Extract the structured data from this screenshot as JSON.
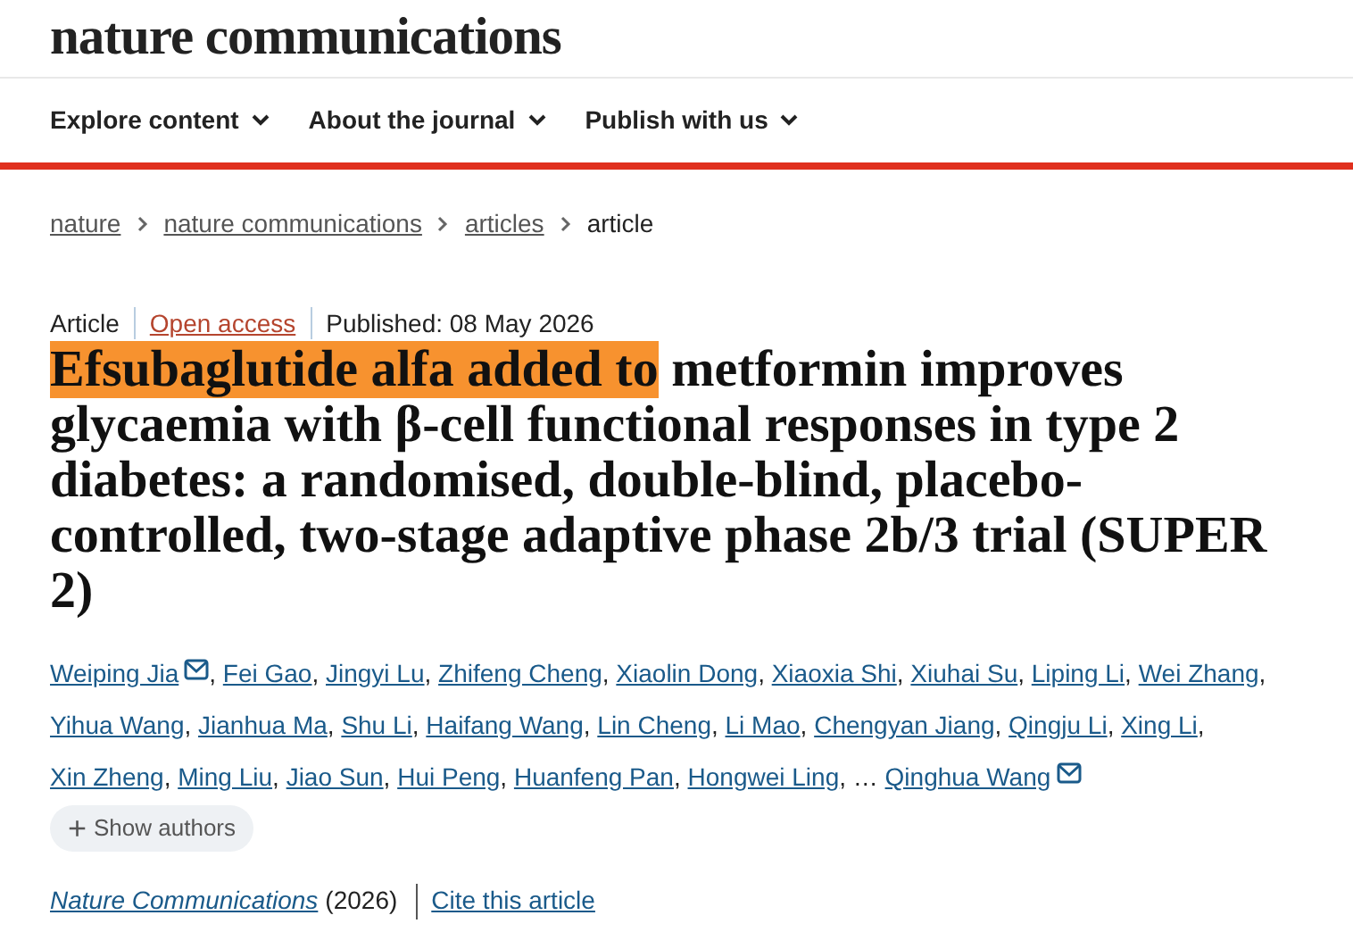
{
  "header": {
    "logo": "nature communications"
  },
  "nav": [
    {
      "label": "Explore content"
    },
    {
      "label": "About the journal"
    },
    {
      "label": "Publish with us"
    }
  ],
  "breadcrumb": [
    {
      "label": "nature",
      "link": true
    },
    {
      "label": "nature communications",
      "link": true
    },
    {
      "label": "articles",
      "link": true
    },
    {
      "label": "article",
      "link": false
    }
  ],
  "meta": {
    "type": "Article",
    "access": "Open access",
    "published": "Published: 08 May 2026"
  },
  "title": {
    "highlighted": "Efsubaglutide alfa added to",
    "rest": "metformin improves glycaemia with β-cell functional responses in type 2 diabetes: a randomised, double-blind, placebo-controlled, two-stage adaptive phase 2b/3 trial (SUPER 2)"
  },
  "authors": [
    {
      "kind": "author",
      "name": "Weiping Jia",
      "corresponding": true,
      "after": ","
    },
    {
      "kind": "author",
      "name": "Fei Gao",
      "corresponding": false,
      "after": ","
    },
    {
      "kind": "author",
      "name": "Jingyi Lu",
      "corresponding": false,
      "after": ","
    },
    {
      "kind": "author",
      "name": "Zhifeng Cheng",
      "corresponding": false,
      "after": ","
    },
    {
      "kind": "author",
      "name": "Xiaolin Dong",
      "corresponding": false,
      "after": ","
    },
    {
      "kind": "author",
      "name": "Xiaoxia Shi",
      "corresponding": false,
      "after": ","
    },
    {
      "kind": "author",
      "name": "Xiuhai Su",
      "corresponding": false,
      "after": ","
    },
    {
      "kind": "author",
      "name": "Liping Li",
      "corresponding": false,
      "after": ","
    },
    {
      "kind": "author",
      "name": "Wei Zhang",
      "corresponding": false,
      "after": ","
    },
    {
      "kind": "author",
      "name": "Yihua Wang",
      "corresponding": false,
      "after": ","
    },
    {
      "kind": "author",
      "name": "Jianhua Ma",
      "corresponding": false,
      "after": ","
    },
    {
      "kind": "author",
      "name": "Shu Li",
      "corresponding": false,
      "after": ","
    },
    {
      "kind": "author",
      "name": "Haifang Wang",
      "corresponding": false,
      "after": ","
    },
    {
      "kind": "author",
      "name": "Lin Cheng",
      "corresponding": false,
      "after": ","
    },
    {
      "kind": "author",
      "name": "Li Mao",
      "corresponding": false,
      "after": ","
    },
    {
      "kind": "author",
      "name": "Chengyan Jiang",
      "corresponding": false,
      "after": ","
    },
    {
      "kind": "author",
      "name": "Qingju Li",
      "corresponding": false,
      "after": ","
    },
    {
      "kind": "author",
      "name": "Xing Li",
      "corresponding": false,
      "after": ","
    },
    {
      "kind": "author",
      "name": "Xin Zheng",
      "corresponding": false,
      "after": ","
    },
    {
      "kind": "author",
      "name": "Ming Liu",
      "corresponding": false,
      "after": ","
    },
    {
      "kind": "author",
      "name": "Jiao Sun",
      "corresponding": false,
      "after": ","
    },
    {
      "kind": "author",
      "name": "Hui Peng",
      "corresponding": false,
      "after": ","
    },
    {
      "kind": "author",
      "name": "Huanfeng Pan",
      "corresponding": false,
      "after": ","
    },
    {
      "kind": "author",
      "name": "Hongwei Ling",
      "corresponding": false,
      "after": ","
    },
    {
      "kind": "gap",
      "name": "…"
    },
    {
      "kind": "author",
      "name": "Qinghua Wang",
      "corresponding": true
    }
  ],
  "show_authors": {
    "icon": "+",
    "label": "Show authors"
  },
  "citation": {
    "journal": "Nature Communications",
    "year": "(2026)",
    "cite": "Cite this article"
  }
}
